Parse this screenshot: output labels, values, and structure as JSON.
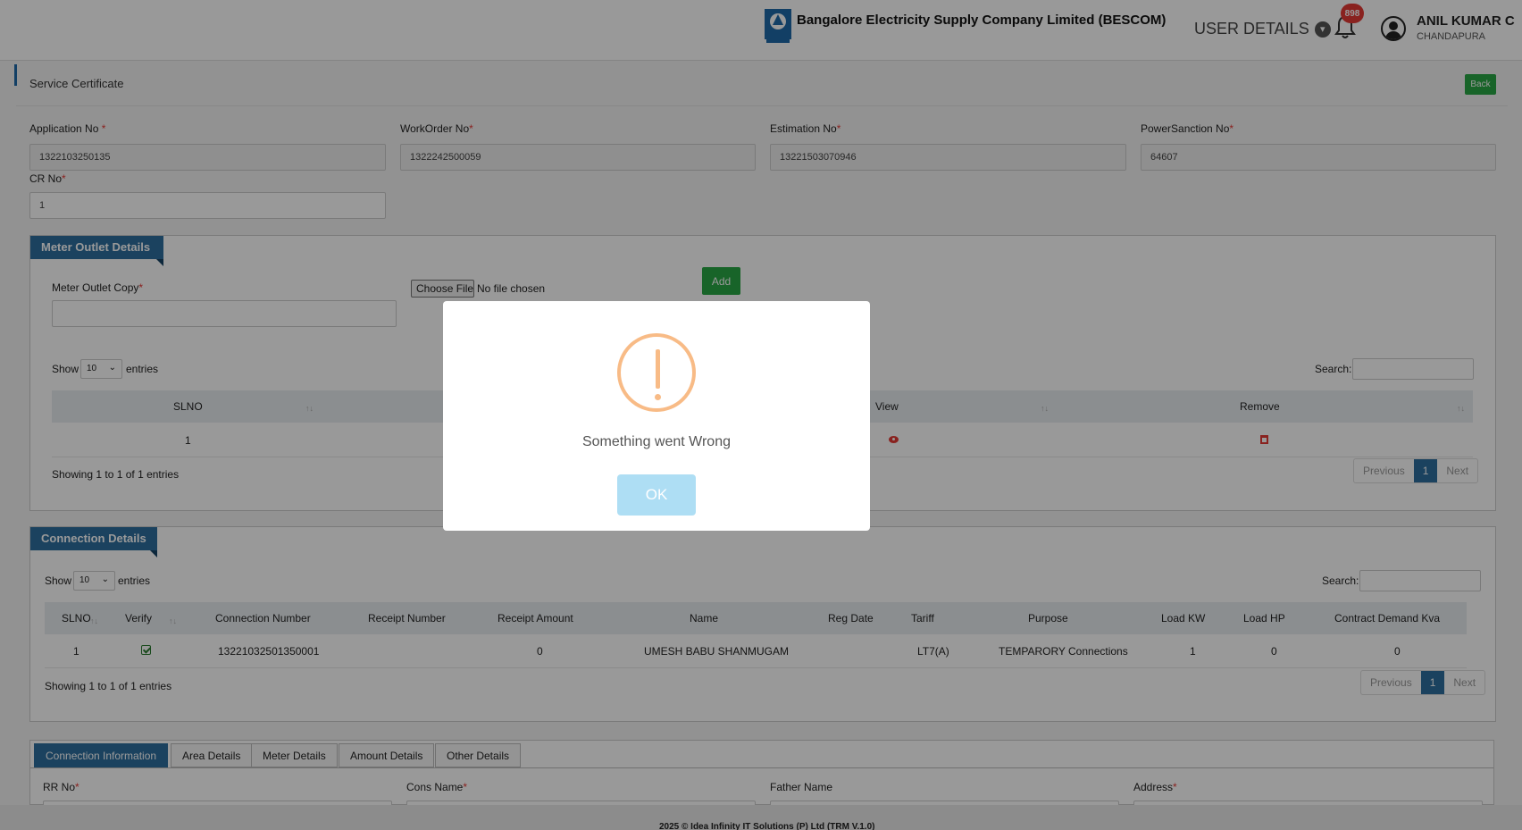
{
  "header": {
    "org_name": "Bangalore Electricity Supply Company Limited (BESCOM)",
    "logo_text": "BESCOM",
    "user_details_label": "USER DETAILS",
    "notification_count": "898",
    "user_name": "ANIL KUMAR C",
    "user_location": "CHANDAPURA"
  },
  "page": {
    "title": "Service Certificate",
    "back_label": "Back"
  },
  "form": {
    "application_no": {
      "label": "Application No",
      "value": "1322103250135"
    },
    "workorder_no": {
      "label": "WorkOrder No",
      "value": "1322242500059"
    },
    "estimation_no": {
      "label": "Estimation No",
      "value": "13221503070946"
    },
    "powersanction_no": {
      "label": "PowerSanction No",
      "value": "64607"
    },
    "cr_no": {
      "label": "CR No",
      "value": "1"
    },
    "required_mark": "*"
  },
  "meter_outlet": {
    "title": "Meter Outlet Details",
    "copy_label": "Meter Outlet Copy",
    "choose_file": "Choose File",
    "no_file": "No file chosen",
    "add_label": "Add",
    "show": "Show",
    "entries_select": "10",
    "entries": "entries",
    "search": "Search:",
    "columns": {
      "slno": "SLNO",
      "view": "View",
      "remove": "Remove"
    },
    "rows": [
      {
        "slno": "1"
      }
    ],
    "info": "Showing 1 to 1 of 1 entries",
    "pager": {
      "prev": "Previous",
      "page": "1",
      "next": "Next"
    }
  },
  "connection": {
    "title": "Connection Details",
    "show": "Show",
    "entries_select": "10",
    "entries": "entries",
    "search": "Search:",
    "columns": [
      "SLNO",
      "Verify",
      "Connection Number",
      "Receipt Number",
      "Receipt Amount",
      "Name",
      "Reg Date",
      "Tariff",
      "Purpose",
      "Load KW",
      "Load HP",
      "Contract Demand Kva"
    ],
    "rows": [
      {
        "slno": "1",
        "connection_number": "13221032501350001",
        "receipt_number": "",
        "receipt_amount": "0",
        "name": "UMESH BABU SHANMUGAM",
        "reg_date": "",
        "tariff": "LT7(A)",
        "purpose": "TEMPARORY Connections",
        "load_kw": "1",
        "load_hp": "0",
        "contract_demand": "0"
      }
    ],
    "info": "Showing 1 to 1 of 1 entries",
    "pager": {
      "prev": "Previous",
      "page": "1",
      "next": "Next"
    }
  },
  "tabs": [
    "Connection Information",
    "Area Details",
    "Meter Details",
    "Amount Details",
    "Other Details"
  ],
  "tab_fields": {
    "rr_no": "RR No",
    "cons_name": "Cons Name",
    "father_name": "Father Name",
    "address": "Address"
  },
  "footer": "2025 © Idea Infinity IT Solutions (P) Ltd (TRM V.1.0)",
  "modal": {
    "message": "Something went Wrong",
    "ok_label": "OK"
  },
  "colors": {
    "primary": "#2d6f9f",
    "success": "#28a745",
    "danger": "#e53935",
    "warning": "#f8bb86",
    "ok_button": "#aedef4"
  }
}
